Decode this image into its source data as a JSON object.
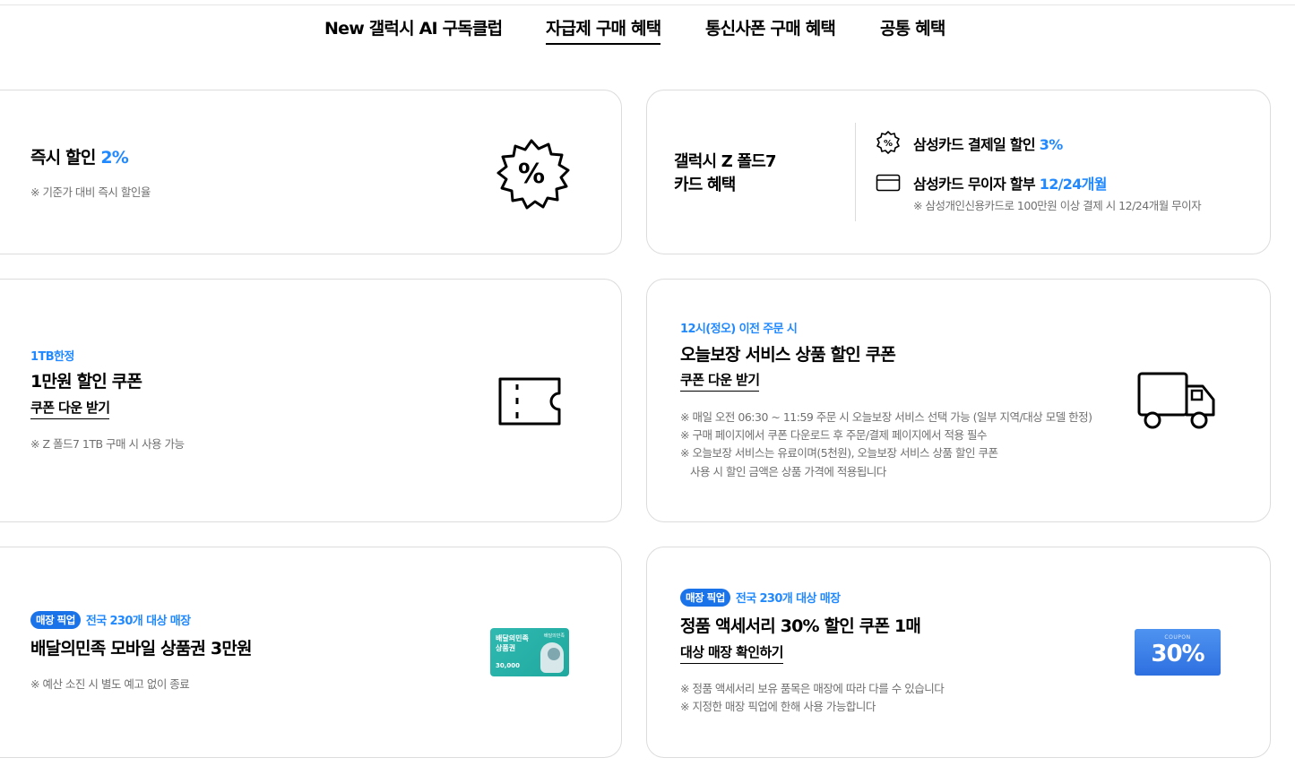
{
  "tabs": [
    {
      "label": "New 갤럭시 AI 구독클럽",
      "active": false
    },
    {
      "label": "자급제 구매 혜택",
      "active": true
    },
    {
      "label": "통신사폰 구매 혜택",
      "active": false
    },
    {
      "label": "공통 혜택",
      "active": false
    }
  ],
  "card1": {
    "title_prefix": "즉시 할인 ",
    "title_highlight": "2%",
    "note": "※ 기준가 대비 즉시 할인율",
    "icon": "percent-badge-icon"
  },
  "card2": {
    "title_line1": "갤럭시 Z 폴드7",
    "title_line2": "카드 혜택",
    "benefit1_prefix": "삼성카드 결제일 할인 ",
    "benefit1_highlight": "3%",
    "benefit1_icon": "percent-badge-icon",
    "benefit2_prefix": "삼성카드 무이자 할부 ",
    "benefit2_highlight": "12/24개월",
    "benefit2_icon": "credit-card-icon",
    "benefit2_note": "※ 삼성개인신용카드로 100만원 이상 결제 시 12/24개월 무이자"
  },
  "card3": {
    "eyebrow": "1TB한정",
    "title": "1만원 할인 쿠폰",
    "link": "쿠폰 다운 받기",
    "note": "※ Z 폴드7 1TB 구매 시 사용 가능",
    "icon": "ticket-icon"
  },
  "card4": {
    "eyebrow": "12시(정오) 이전 주문 시",
    "title": "오늘보장 서비스 상품 할인 쿠폰",
    "link": "쿠폰 다운 받기",
    "notes": [
      "※ 매일 오전 06:30 ~ 11:59 주문 시 오늘보장 서비스 선택 가능 (일부 지역/대상 모델 한정)",
      "※ 구매 페이지에서 쿠폰 다운로드 후 주문/결제 페이지에서 적용 필수",
      "※ 오늘보장 서비스는 유료이며(5천원), 오늘보장 서비스 상품 할인 쿠폰",
      "사용 시 할인 금액은 상품 가격에 적용됩니다"
    ],
    "icon": "delivery-truck-icon"
  },
  "card5": {
    "badge": "매장 픽업",
    "eyebrow": "전국 230개 대상 매장",
    "title": "배달의민족 모바일 상품권 3만원",
    "note": "※ 예산 소진 시 별도 예고 없이 종료",
    "giftcard": {
      "brand": "배달의민족",
      "line1": "배달의민족",
      "line2": "상품권",
      "amount": "30,000"
    }
  },
  "card6": {
    "badge": "매장 픽업",
    "eyebrow": "전국 230개 대상 매장",
    "title": "정품 액세서리 30% 할인 쿠폰 1매",
    "link": "대상 매장 확인하기",
    "notes": [
      "※ 정품 액세서리 보유 품목은 매장에 따라 다를 수 있습니다",
      "※ 지정한 매장 픽업에 한해 사용 가능합니다"
    ],
    "coupon": {
      "label": "COUPON",
      "value": "30%"
    }
  },
  "colors": {
    "accent_blue": "#2189ff",
    "badge_blue": "#1a73e8",
    "border": "#dcdcdc",
    "note_gray": "#707070"
  }
}
